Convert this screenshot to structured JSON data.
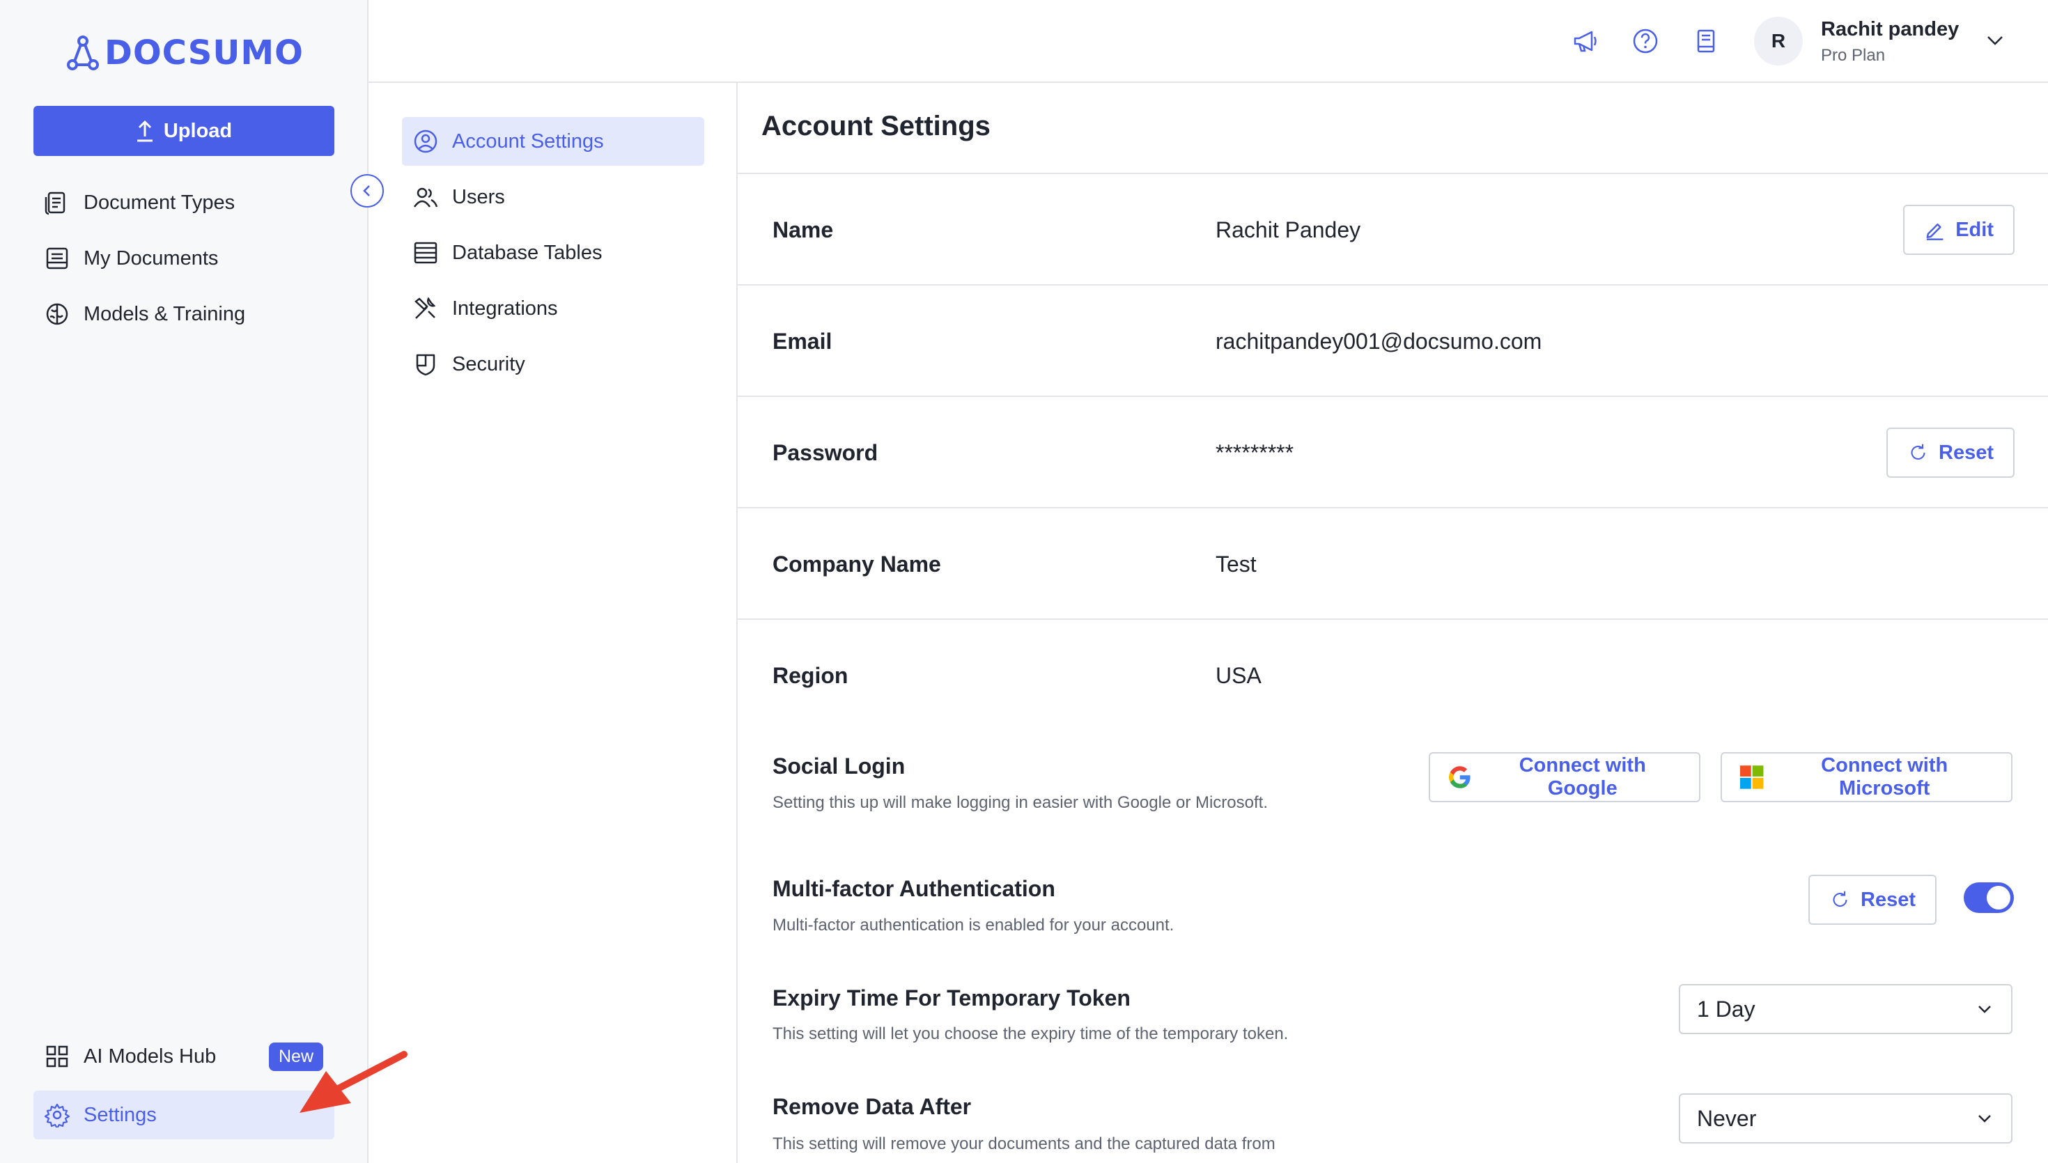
{
  "brand": {
    "logo_text": "DOCSUMO",
    "accent_color": "#4a5fe7",
    "accent_light": "#e4e8fd"
  },
  "sidebar": {
    "upload_label": "Upload",
    "items": [
      {
        "label": "Document Types",
        "icon": "document-types-icon"
      },
      {
        "label": "My Documents",
        "icon": "my-documents-icon"
      },
      {
        "label": "Models & Training",
        "icon": "brain-icon"
      }
    ],
    "bottom_items": [
      {
        "label": "AI Models Hub",
        "icon": "grid-icon",
        "badge": "New"
      },
      {
        "label": "Settings",
        "icon": "gear-icon",
        "active": true
      }
    ]
  },
  "header": {
    "icons": [
      "megaphone-icon",
      "help-icon",
      "book-icon"
    ],
    "user": {
      "initial": "R",
      "name": "Rachit pandey",
      "plan": "Pro Plan"
    }
  },
  "settings_nav": {
    "items": [
      {
        "label": "Account Settings",
        "icon": "user-circle-icon",
        "active": true
      },
      {
        "label": "Users",
        "icon": "users-icon"
      },
      {
        "label": "Database Tables",
        "icon": "table-icon"
      },
      {
        "label": "Integrations",
        "icon": "tools-icon"
      },
      {
        "label": "Security",
        "icon": "shield-icon"
      }
    ]
  },
  "account": {
    "title": "Account Settings",
    "name_label": "Name",
    "name_value": "Rachit Pandey",
    "edit_label": "Edit",
    "email_label": "Email",
    "email_value": "rachitpandey001@docsumo.com",
    "password_label": "Password",
    "password_value": "*********",
    "reset_label": "Reset",
    "company_label": "Company Name",
    "company_value": "Test",
    "region_label": "Region",
    "region_value": "USA",
    "social_title": "Social Login",
    "social_desc": "Setting this up will make logging in easier with Google or Microsoft.",
    "google_label": "Connect with Google",
    "microsoft_label": "Connect with Microsoft",
    "mfa_title": "Multi-factor Authentication",
    "mfa_desc": "Multi-factor authentication is enabled for your account.",
    "mfa_reset_label": "Reset",
    "mfa_enabled": true,
    "expiry_title": "Expiry Time For Temporary Token",
    "expiry_desc": "This setting will let you choose the expiry time of the temporary token.",
    "expiry_value": "1 Day",
    "remove_title": "Remove Data After",
    "remove_desc": "This setting will remove your documents and the captured data from",
    "remove_value": "Never"
  }
}
